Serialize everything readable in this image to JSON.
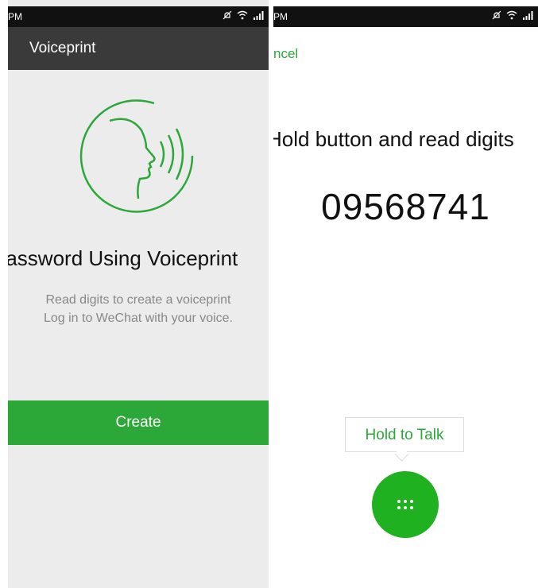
{
  "left_screen": {
    "status_time": "PM",
    "title": "Voiceprint",
    "heading": "Password Using Voiceprint",
    "description_line1": "Read digits to create a voiceprint",
    "description_line2": "Log in to WeChat with your voice.",
    "create_label": "Create",
    "icon": "voiceprint-face-icon"
  },
  "right_screen": {
    "status_time": "PM",
    "cancel_label": "ncel",
    "instruction": "Hold button and read digits",
    "digits": "09568741",
    "tooltip": "Hold to Talk",
    "talk_icon": "keypad-dots-icon"
  },
  "status_icons": [
    "mute-icon",
    "wifi-icon",
    "signal-icon"
  ],
  "colors": {
    "accent_green": "#2ba838",
    "title_bar": "#3a3a3a",
    "status_bar": "#111111",
    "left_background": "#ececec"
  }
}
